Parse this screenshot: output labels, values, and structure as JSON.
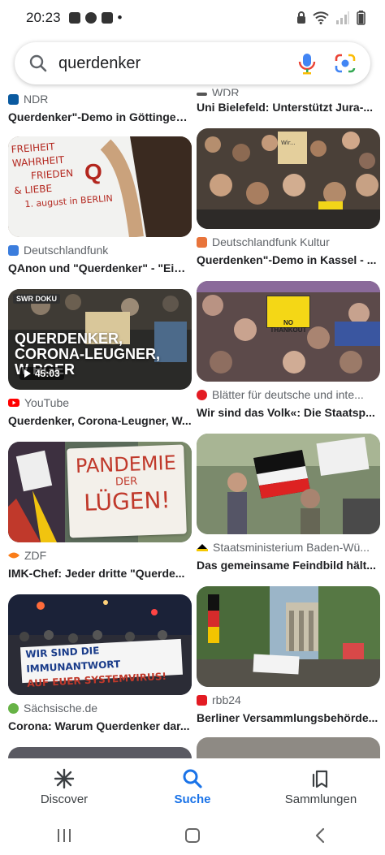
{
  "status_bar": {
    "time": "20:23"
  },
  "search": {
    "value": "querdenker"
  },
  "feed": {
    "left": [
      {
        "source": "NDR",
        "title": "Querdenker\"-Demo in Göttingen..."
      },
      {
        "source": "Deutschlandfunk",
        "title": "QAnon und \"Querdenker\" - \"Eine..."
      },
      {
        "source": "YouTube",
        "title": "Querdenker, Corona-Leugner, W..."
      },
      {
        "source": "ZDF",
        "title": "IMK-Chef: Jeder dritte \"Querde..."
      },
      {
        "source": "Sächsische.de",
        "title": "Corona: Warum Querdenker dar..."
      }
    ],
    "right": [
      {
        "source": "WDR",
        "title": "Uni Bielefeld: Unterstützt Jura-..."
      },
      {
        "source": "Deutschlandfunk Kultur",
        "title": "Querdenken\"-Demo in Kassel - ..."
      },
      {
        "source": "Blätter für deutsche und inte...",
        "title": "Wir sind das Volk«: Die Staatsp..."
      },
      {
        "source": "Staatsministerium Baden-Wü...",
        "title": "Das gemeinsame Feindbild hält..."
      },
      {
        "source": "rbb24",
        "title": "Berliner Versammlungsbehörde..."
      }
    ]
  },
  "image_text": {
    "sign1_l1": "FREIHEIT",
    "sign1_l2": "WAHRHEIT",
    "sign1_l3": "FRIEDEN",
    "sign1_l4": "& LIEBE",
    "sign1_l5": "1. august in BERLIN",
    "sign1_q": "Q",
    "yt_badge": "SWR DOKU",
    "yt_l1": "QUERDENKER,",
    "yt_l2": "CORONA-LEUGNER,",
    "yt_l3": "W RGER",
    "yt_duration": "45:03",
    "zdf_sign_l1": "PANDEMIE",
    "zdf_sign_l2": "DER",
    "zdf_sign_l3": "LÜGEN!",
    "sz_banner_l1": "WIR SIND DIE IMMUNANTWORT",
    "sz_banner_l2": "AUF EUER SYSTEMVIRUS!",
    "blaetter_sign": "NO THANKOUT",
    "kassel_sign": "Wir..."
  },
  "bottom_nav": {
    "discover": "Discover",
    "suche": "Suche",
    "sammlungen": "Sammlungen"
  },
  "colors": {
    "accent": "#1a73e8",
    "youtube": "#ff0000",
    "ndr": "#0a5aa0",
    "dlf": "#3b7ddd",
    "dlfk": "#e8743b",
    "zdf": "#fa7d19",
    "sz": "#67b346",
    "rbb": "#e31b23"
  }
}
